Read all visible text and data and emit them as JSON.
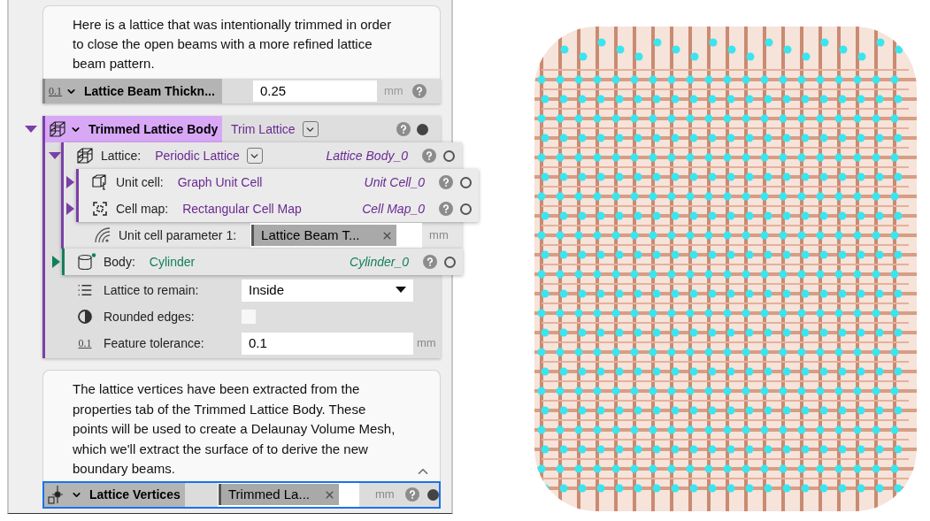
{
  "intro_note": {
    "text": "Here is a lattice that was intentionally trimmed in order to close the open beams with a more refined lattice beam pattern."
  },
  "beam_thickness": {
    "icon_label": "0.1",
    "label": "Lattice Beam Thickn...",
    "value": "0.25",
    "unit": "mm"
  },
  "trimmed_body": {
    "name": "Trimmed Lattice Body",
    "type": "Trim Lattice",
    "expanded": true,
    "dot_filled": true,
    "lattice": {
      "label": "Lattice:",
      "value": "Periodic Lattice",
      "ref": "Lattice Body_0",
      "expanded": true,
      "dot_filled": false,
      "color": "#6a2a92",
      "unit_cell": {
        "label": "Unit cell:",
        "value": "Graph Unit Cell",
        "ref": "Unit Cell_0",
        "expanded": false,
        "dot_filled": false,
        "color": "#6a2a92"
      },
      "cell_map": {
        "label": "Cell map:",
        "value": "Rectangular Cell Map",
        "ref": "Cell Map_0",
        "expanded": false,
        "dot_filled": false,
        "color": "#6a2a92"
      },
      "parameter": {
        "label": "Unit cell parameter 1:",
        "value": "Lattice Beam T...",
        "unit": "mm"
      }
    },
    "body": {
      "label": "Body:",
      "value": "Cylinder",
      "ref": "Cylinder_0",
      "expanded": false,
      "dot_filled": false,
      "color": "#13805c"
    },
    "properties": [
      {
        "kind": "dropdown",
        "label": "Lattice to remain:",
        "value": "Inside"
      },
      {
        "kind": "checkbox",
        "label": "Rounded edges:",
        "checked": false
      },
      {
        "kind": "number",
        "icon_label": "0.1",
        "label": "Feature tolerance:",
        "value": "0.1",
        "unit": "mm"
      }
    ]
  },
  "second_note": {
    "text": "The lattice vertices have been extracted from the properties tab of the Trimmed Lattice Body. These points will be used to create a Delaunay Volume Mesh, which we'll extract the surface of to derive the new boundary beams."
  },
  "vertices": {
    "name": "Lattice Vertices",
    "value": "Trimmed La...",
    "unit": "mm",
    "selected": true,
    "dot_filled": true
  }
}
